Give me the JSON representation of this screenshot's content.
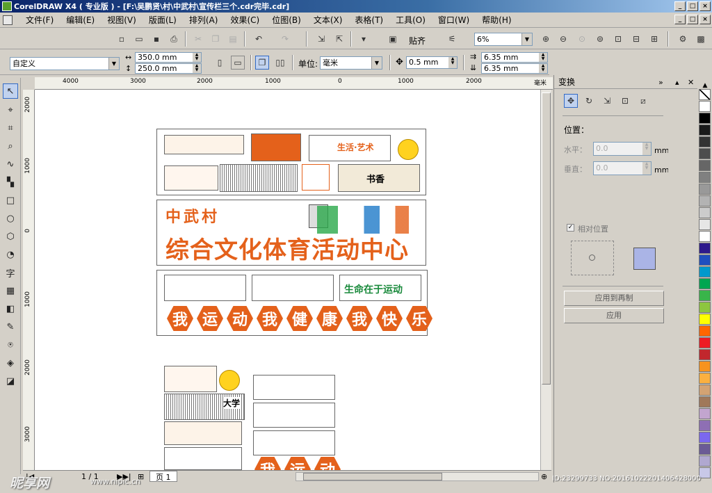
{
  "window": {
    "title": "CorelDRAW X4 ( 专业版 ) - [F:\\吴鹏贤\\村\\中武村\\宣传栏三个.cdr完毕.cdr]",
    "min": "_",
    "max": "□",
    "close": "×"
  },
  "menu": {
    "items": [
      "文件(F)",
      "编辑(E)",
      "视图(V)",
      "版面(L)",
      "排列(A)",
      "效果(C)",
      "位图(B)",
      "文本(X)",
      "表格(T)",
      "工具(O)",
      "窗口(W)",
      "帮助(H)"
    ]
  },
  "toolbar": {
    "snap_label": "贴齐",
    "zoom_value": "6%"
  },
  "property_bar": {
    "preset": "自定义",
    "width": "350.0 mm",
    "height": "250.0 mm",
    "unit_label": "单位:",
    "unit_value": "毫米",
    "nudge": "0.5 mm",
    "dup_x": "6.35 mm",
    "dup_y": "6.35 mm"
  },
  "ruler": {
    "h_labels": [
      "4000",
      "3000",
      "2000",
      "1000",
      "0",
      "1000",
      "2000"
    ],
    "h_unit": "毫米",
    "v_labels": [
      "2000",
      "1000",
      "0",
      "1000",
      "2000",
      "3000"
    ]
  },
  "canvas_art": {
    "village_name": "中武村",
    "center_title": "综合文化体育活动中心",
    "slogan_chars": [
      "我",
      "运",
      "动",
      "我",
      "健",
      "康",
      "我",
      "快",
      "乐"
    ],
    "sport_banner": "生命在于运动",
    "book_text": "书香",
    "art_text": "生活·艺术",
    "motto_text": "大学"
  },
  "pager": {
    "count": "1 / 1",
    "page_tab": "页 1"
  },
  "panel": {
    "title": "变换",
    "position_label": "位置：",
    "h_label": "水平：",
    "h_value": "0.0",
    "h_unit": "mm",
    "v_label": "垂直：",
    "v_value": "0.0",
    "v_unit": "mm",
    "relative_label": "相对位置",
    "apply_dup": "应用到再制",
    "apply": "应用"
  },
  "watermark": {
    "site": "昵享网",
    "url": "www.nipic.cn",
    "id": "ID:23299733 NO:20161022201406428000"
  },
  "colors": {
    "accent_orange": "#e4611b",
    "title_blue": "#0a246a"
  },
  "palette": [
    "#ffffff",
    "#000000",
    "#1a1a1a",
    "#333333",
    "#4d4d4d",
    "#666666",
    "#808080",
    "#999999",
    "#b3b3b3",
    "#cccccc",
    "#e6e6e6",
    "#ffffff",
    "#2e1a8c",
    "#1f4fbf",
    "#0099cc",
    "#00a651",
    "#39b54a",
    "#8dc63f",
    "#ffff00",
    "#ff6600",
    "#ed1c24",
    "#c1272d",
    "#f7931e",
    "#fbb040",
    "#d4a373",
    "#a0785a",
    "#c2a5cf",
    "#8e6fb4",
    "#7b68ee",
    "#6b5b95",
    "#b0a8d0",
    "#c8c8e8"
  ]
}
